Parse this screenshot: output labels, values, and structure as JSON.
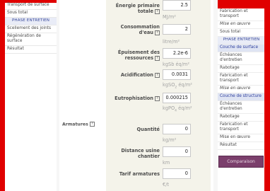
{
  "left_sidebar": {
    "items": [
      {
        "label": "Transport de surface"
      },
      {
        "label": "Sous total"
      },
      {
        "label": "PHASE ENTRETIEN",
        "header": true
      },
      {
        "label": "Scellement des joints"
      },
      {
        "label": "Régénération de surface"
      },
      {
        "label": "Résultat"
      }
    ]
  },
  "main": {
    "partial_top": {
      "label": "Énergie primaire totale",
      "value": "2.5",
      "unit": "MJ/m²"
    },
    "fields": [
      {
        "label": "Consommation d'eau",
        "value": "2",
        "unit": "litre/m²"
      },
      {
        "label": "Épuisement des ressources",
        "value": "2.2e-6",
        "unit": "kgSb éq/m²"
      },
      {
        "label": "Acidification",
        "value": "0.0031",
        "unit_pre": "kgSO",
        "unit_sub": "2",
        "unit_post": " éq/m²"
      },
      {
        "label": "Eutrophisation",
        "value": "0.000215",
        "unit_pre": "kgPO",
        "unit_sub": "4",
        "unit_post": " éq/m²"
      }
    ],
    "armatures": {
      "section_label": "Armatures",
      "fields": [
        {
          "label": "Quantité",
          "value": "0",
          "unit": "kg/m²"
        },
        {
          "label": "Distance usine chantier",
          "value": "0",
          "unit": "km"
        },
        {
          "label": "Tarif armatures",
          "value": "0",
          "unit": "€/t"
        }
      ]
    },
    "help_glyph": "?"
  },
  "right_sidebar": {
    "items": [
      {
        "label": "Fabrication et transport"
      },
      {
        "label": "Mise en œuvre",
        "italic": true
      },
      {
        "label": "Sous total"
      },
      {
        "label": "PHASE ENTRETIEN",
        "header": true
      },
      {
        "label": "Couche de surface",
        "sub": true
      },
      {
        "label": "Échéances d'entretien"
      },
      {
        "label": "Rabotage"
      },
      {
        "label": "Fabrication et transport"
      },
      {
        "label": "Mise en œuvre",
        "italic": true
      },
      {
        "label": "Couche de structure",
        "sub": true
      },
      {
        "label": "Échéances d'entretien"
      },
      {
        "label": "Rabotage"
      },
      {
        "label": "Fabrication et transport"
      },
      {
        "label": "Mise en œuvre"
      },
      {
        "label": "Résultat"
      }
    ],
    "button_label": "Comparaison"
  }
}
